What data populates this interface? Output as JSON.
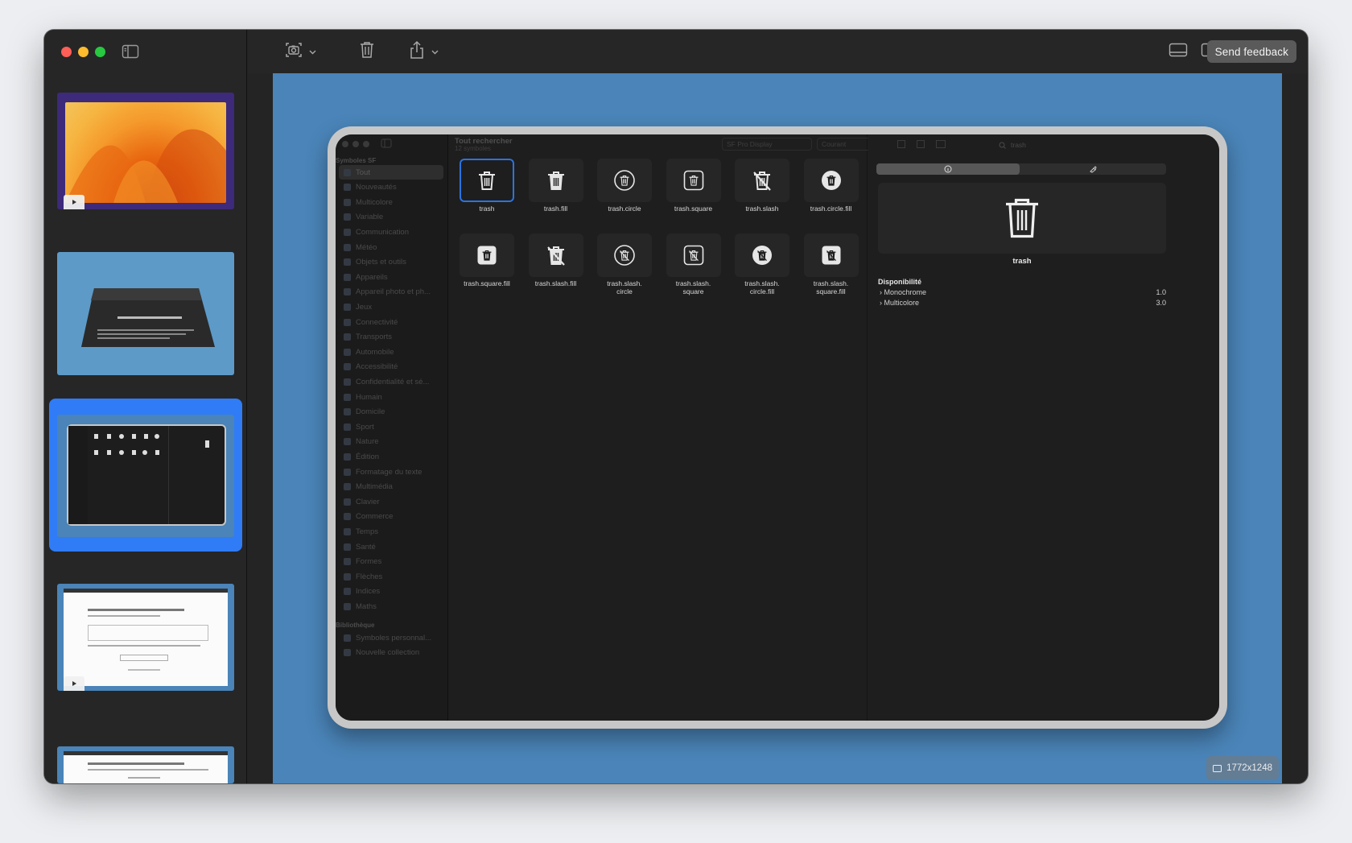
{
  "toolbar": {
    "send_feedback": "Send feedback",
    "icons": [
      "sidebar-toggle-icon",
      "screenshot-icon",
      "chevron-down-icon",
      "trash-icon",
      "share-icon",
      "chevron-down-icon",
      "bottom-panel-icon",
      "right-panel-icon",
      "chevron-down-icon"
    ]
  },
  "canvas": {
    "dimensions": "1772x1248",
    "background": "#4a84b8"
  },
  "thumbnails": [
    {
      "kind": "desktop"
    },
    {
      "kind": "tilted-screen"
    },
    {
      "kind": "sf-symbols",
      "selected": true
    },
    {
      "kind": "document"
    },
    {
      "kind": "document"
    }
  ],
  "embedded": {
    "title": "Tout rechercher",
    "subtitle": "12 symboles",
    "font_select": "SF Pro Display",
    "weight_select": "Courant",
    "search_value": "trash",
    "sidebar_section_1": "Symboles SF",
    "sidebar_items": [
      "Tout",
      "Nouveautés",
      "Multicolore",
      "Variable",
      "Communication",
      "Météo",
      "Objets et outils",
      "Appareils",
      "Appareil photo et ph...",
      "Jeux",
      "Connectivité",
      "Transports",
      "Automobile",
      "Accessibilité",
      "Confidentialité et sé...",
      "Humain",
      "Domicile",
      "Sport",
      "Nature",
      "Édition",
      "Formatage du texte",
      "Multimédia",
      "Clavier",
      "Commerce",
      "Temps",
      "Santé",
      "Formes",
      "Flèches",
      "Indices",
      "Maths"
    ],
    "sidebar_section_2": "Bibliothèque",
    "library_items": [
      "Symboles personnal...",
      "Nouvelle collection"
    ],
    "symbols": [
      {
        "name": "trash",
        "label": "trash"
      },
      {
        "name": "trash.fill",
        "label": "trash.fill"
      },
      {
        "name": "trash.circle",
        "label": "trash.circle"
      },
      {
        "name": "trash.square",
        "label": "trash.square"
      },
      {
        "name": "trash.slash",
        "label": "trash.slash"
      },
      {
        "name": "trash.circle.fill",
        "label": "trash.circle.fill"
      },
      {
        "name": "trash.square.fill",
        "label": "trash.square.fill"
      },
      {
        "name": "trash.slash.fill",
        "label": "trash.slash.fill"
      },
      {
        "name": "trash.slash.circle",
        "label": "trash.slash.\ncircle"
      },
      {
        "name": "trash.slash.square",
        "label": "trash.slash.\nsquare"
      },
      {
        "name": "trash.slash.circle.fill",
        "label": "trash.slash.\ncircle.fill"
      },
      {
        "name": "trash.slash.square.fill",
        "label": "trash.slash.\nsquare.fill"
      }
    ],
    "inspector": {
      "symbol_name": "trash",
      "availability_header": "Disponibilité",
      "rows": [
        {
          "label": "Monochrome",
          "value": "1.0"
        },
        {
          "label": "Multicolore",
          "value": "3.0"
        }
      ]
    }
  }
}
